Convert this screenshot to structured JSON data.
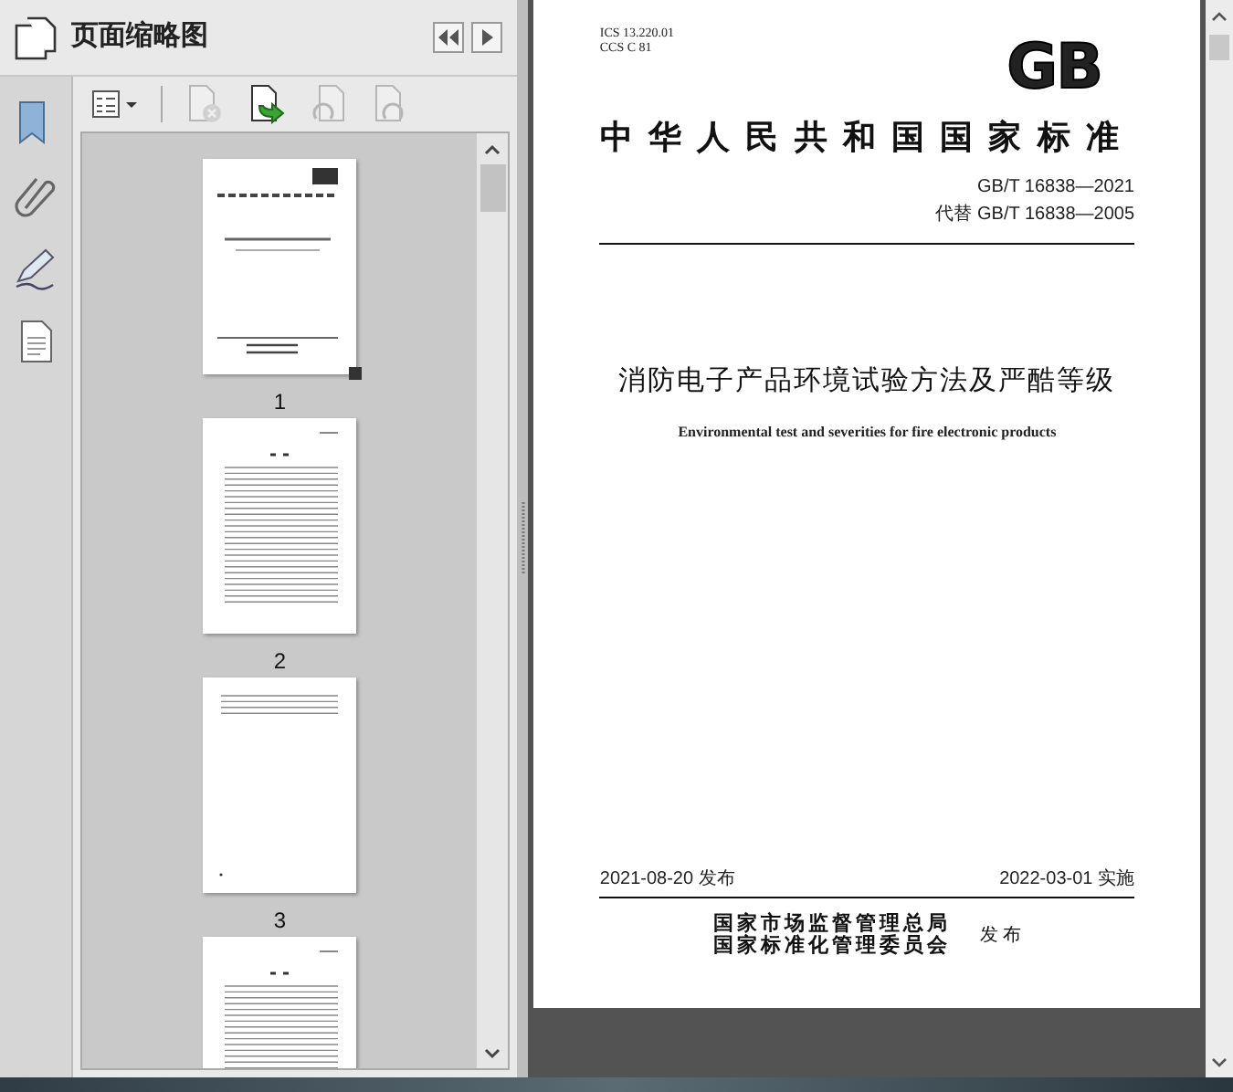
{
  "panel": {
    "title": "页面缩略图"
  },
  "rail": [
    {
      "kind": "bookmark"
    },
    {
      "kind": "clip"
    },
    {
      "kind": "pen"
    },
    {
      "kind": "page"
    }
  ],
  "toolbar": [
    {
      "kind": "menu",
      "disabled": false
    },
    {
      "kind": "delete",
      "disabled": true
    },
    {
      "kind": "insert",
      "disabled": false
    },
    {
      "kind": "rotate-left",
      "disabled": true
    },
    {
      "kind": "rotate-right",
      "disabled": true
    }
  ],
  "thumbnails": [
    {
      "page": "1",
      "kind": "cover",
      "current": true
    },
    {
      "page": "2",
      "kind": "contents",
      "current": false
    },
    {
      "page": "3",
      "kind": "short",
      "current": false
    },
    {
      "kind": "contents",
      "current": false
    }
  ],
  "document": {
    "ics": "ICS 13.220.01",
    "ccs": "CCS C 81",
    "logo": "GB",
    "national_title": "中华人民共和国国家标准",
    "code": "GB/T 16838—2021",
    "replaces": "代替 GB/T 16838—2005",
    "title_zh": "消防电子产品环境试验方法及严酷等级",
    "title_en": "Environmental test and severities for fire electronic products",
    "issue_date": "2021-08-20 发布",
    "effective_date": "2022-03-01 实施",
    "issuers": [
      "国家市场监督管理总局",
      "国家标准化管理委员会"
    ],
    "issue_word": "发 布"
  }
}
